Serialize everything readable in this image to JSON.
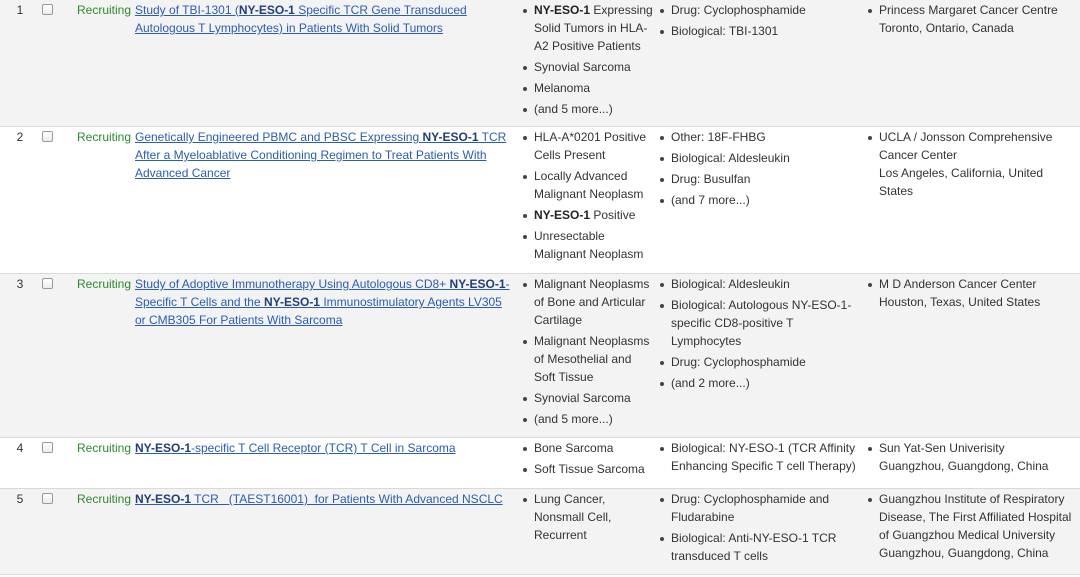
{
  "rows": [
    {
      "number": "1",
      "status": "Recruiting",
      "title": [
        "Study of TBI-1301 (",
        "NY-ESO-1",
        " Specific TCR Gene Transduced Autologous T Lymphocytes) in Patients With Solid Tumors"
      ],
      "conditions": [
        [
          "NY-ESO-1",
          " Expressing Solid Tumors in HLA-A2 Positive Patients"
        ],
        [
          "",
          "Synovial Sarcoma"
        ],
        [
          "",
          "Melanoma"
        ],
        [
          "",
          "(and 5 more...)"
        ]
      ],
      "interventions": [
        "Drug: Cyclophosphamide",
        "Biological: TBI-1301"
      ],
      "location": [
        "Princess Margaret Cancer Centre",
        "Toronto, Ontario, Canada"
      ]
    },
    {
      "number": "2",
      "status": "Recruiting",
      "title": [
        "Genetically Engineered PBMC and PBSC Expressing ",
        "NY-ESO-1",
        " TCR After a Myeloablative Conditioning Regimen to Treat Patients With Advanced Cancer"
      ],
      "conditions": [
        [
          "",
          "HLA-A*0201 Positive Cells Present"
        ],
        [
          "",
          "Locally Advanced Malignant Neoplasm"
        ],
        [
          "NY-ESO-1",
          " Positive"
        ],
        [
          "",
          "Unresectable Malignant Neoplasm"
        ]
      ],
      "interventions": [
        "Other: 18F-FHBG",
        "Biological: Aldesleukin",
        "Drug: Busulfan",
        "(and 7 more...)"
      ],
      "location": [
        "UCLA / Jonsson Comprehensive Cancer Center",
        "Los Angeles, California, United States"
      ]
    },
    {
      "number": "3",
      "status": "Recruiting",
      "title": [
        "Study of Adoptive Immunotherapy Using Autologous CD8+ ",
        "NY-ESO-1",
        "-Specific T Cells and the ",
        "NY-ESO-1",
        " Immunostimulatory Agents LV305 or CMB305 For Patients With Sarcoma"
      ],
      "conditions": [
        [
          "",
          "Malignant Neoplasms of Bone and Articular Cartilage"
        ],
        [
          "",
          "Malignant Neoplasms of Mesothelial and Soft Tissue"
        ],
        [
          "",
          "Synovial Sarcoma"
        ],
        [
          "",
          "(and 5 more...)"
        ]
      ],
      "interventions": [
        "Biological: Aldesleukin",
        "Biological: Autologous NY-ESO-1-specific CD8-positive T Lymphocytes",
        "Drug: Cyclophosphamide",
        "(and 2 more...)"
      ],
      "location": [
        "M D Anderson Cancer Center",
        "Houston, Texas, United States"
      ]
    },
    {
      "number": "4",
      "status": "Recruiting",
      "title": [
        "",
        "NY-ESO-1",
        "-specific T Cell Receptor (TCR) T Cell in Sarcoma"
      ],
      "conditions": [
        [
          "",
          "Bone Sarcoma"
        ],
        [
          "",
          "Soft Tissue Sarcoma"
        ]
      ],
      "interventions": [
        "Biological: NY-ESO-1  (TCR Affinity Enhancing Specific T cell Therapy)"
      ],
      "location": [
        "Sun Yat-Sen Univerisity",
        "Guangzhou, Guangdong, China"
      ]
    },
    {
      "number": "5",
      "status": "Recruiting",
      "title": [
        "",
        "NY-ESO-1",
        " TCR   (TAEST16001)  for Patients With Advanced NSCLC"
      ],
      "conditions": [
        [
          "",
          "Lung Cancer, Nonsmall Cell, Recurrent"
        ]
      ],
      "interventions": [
        "Drug: Cyclophosphamide and Fludarabine",
        "Biological: Anti-NY-ESO-1 TCR transduced T cells"
      ],
      "location": [
        "Guangzhou Institute of Respiratory Disease, The First Affiliated Hospital of Guangzhou Medical University",
        "Guangzhou, Guangdong, China"
      ]
    }
  ]
}
